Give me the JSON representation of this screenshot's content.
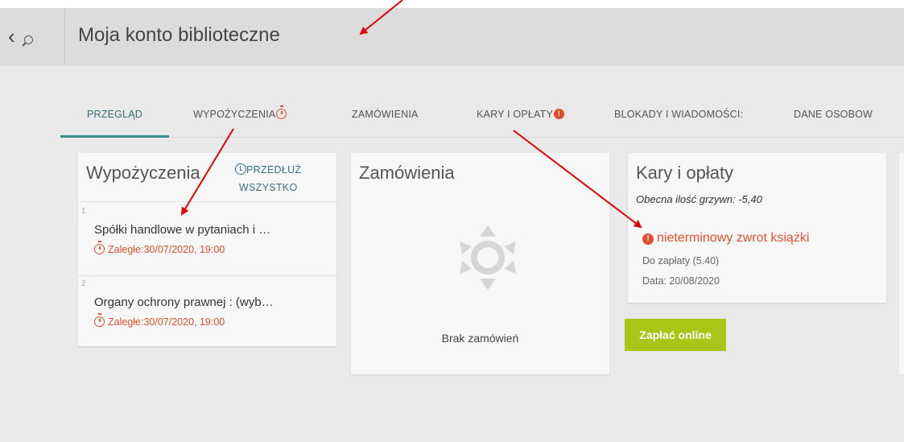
{
  "header": {
    "title": "Moja konto biblioteczne"
  },
  "tabs": [
    {
      "label": "PRZEGLĄD",
      "active": true
    },
    {
      "label": "WYPOŻYCZENIA",
      "icon": "timer-icon"
    },
    {
      "label": "ZAMÓWIENIA"
    },
    {
      "label": "KARY I OPŁATY",
      "badge": "!"
    },
    {
      "label": "BLOKADY I WIADOMOŚCI:"
    },
    {
      "label": "DANE OSOBOW"
    }
  ],
  "loans": {
    "title": "Wypożyczenia",
    "renew_line1": "PRZEDŁUŻ",
    "renew_line2": "WSZYSTKO",
    "items": [
      {
        "num": "1",
        "title": "Spółki handlowe w pytaniach i …",
        "due": "Zaległe:30/07/2020, 19:00"
      },
      {
        "num": "2",
        "title": "Organy ochrony prawnej : (wyb…",
        "due": "Zaległe:30/07/2020, 19:00"
      }
    ]
  },
  "orders": {
    "title": "Zamówienia",
    "empty_text": "Brak zamówień"
  },
  "fees": {
    "title": "Kary i opłaty",
    "subtitle": "Obecna ilość grzywn: -5,40",
    "fee_badge": "!",
    "fee_label": "nieterminowy zwrot książki",
    "amount": "Do zapłaty (5.40)",
    "date": "Data: 20/08/2020"
  },
  "pay_button": "Zapłać online",
  "colors": {
    "accent": "#3a8c8c",
    "overdue": "#e0502d",
    "pay": "#a8c618",
    "annotation": "#e00000"
  }
}
